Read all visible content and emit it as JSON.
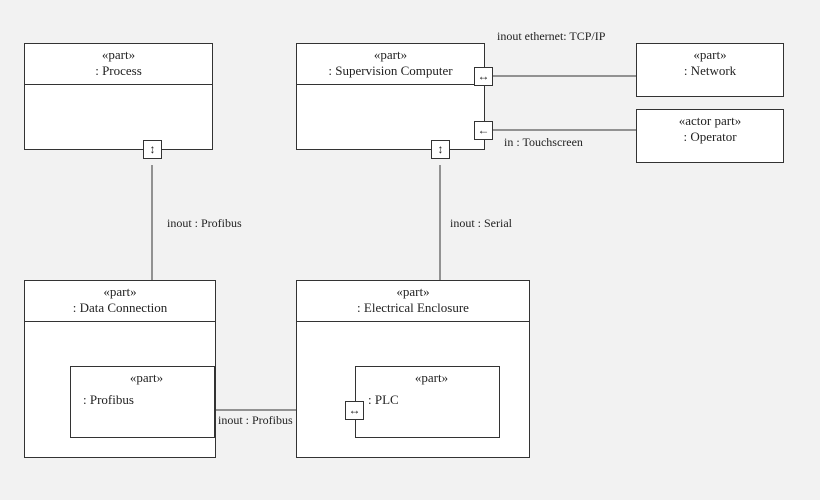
{
  "boxes": {
    "process": {
      "stereo": "«part»",
      "name": ": Process"
    },
    "supervision": {
      "stereo": "«part»",
      "name": ": Supervision Computer"
    },
    "network": {
      "stereo": "«part»",
      "name": ": Network"
    },
    "operator": {
      "stereo": "«actor part»",
      "name": ": Operator"
    },
    "dataconn": {
      "stereo": "«part»",
      "name": ": Data Connection"
    },
    "elecenc": {
      "stereo": "«part»",
      "name": ": Electrical Enclosure"
    },
    "profibus_inner": {
      "stereo": "«part»",
      "name": ": Profibus"
    },
    "plc_inner": {
      "stereo": "«part»",
      "name": ": PLC"
    }
  },
  "ports": {
    "process_out": "↕",
    "super_ethernet": "↔",
    "super_touch": "←",
    "super_serial": "↕",
    "plc_profibus": "↔"
  },
  "labels": {
    "ethernet": "inout ethernet: TCP/IP",
    "touchscreen": "in : Touchscreen",
    "serial": "inout : Serial",
    "profibus1": "inout : Profibus",
    "profibus2": "inout : Profibus"
  }
}
